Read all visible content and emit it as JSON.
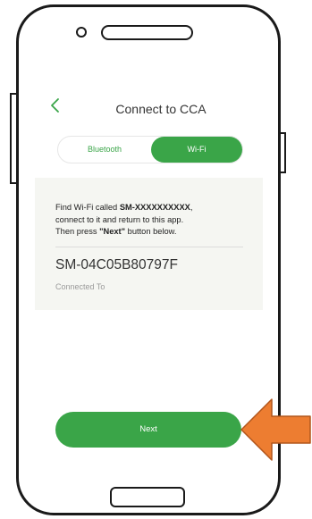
{
  "header": {
    "title": "Connect to CCA",
    "back_icon": "chevron-left-icon"
  },
  "tabs": [
    {
      "label": "Bluetooth",
      "selected": false
    },
    {
      "label": "Wi-Fi",
      "selected": true
    }
  ],
  "info": {
    "line1_prefix": "Find Wi-Fi called ",
    "ssid_pattern": "SM-XXXXXXXXXX",
    "line1_suffix": ",",
    "line2": "connect to it and return to this app.",
    "line3_prefix": "Then press ",
    "line3_button": "\"Next\"",
    "line3_suffix": " button below.",
    "network_name": "SM-04C05B80797F",
    "status": "Connected To"
  },
  "next_button": {
    "label": "Next"
  },
  "colors": {
    "accent": "#3aa548",
    "arrow": "#ed7d31",
    "card": "#f5f6f2"
  }
}
